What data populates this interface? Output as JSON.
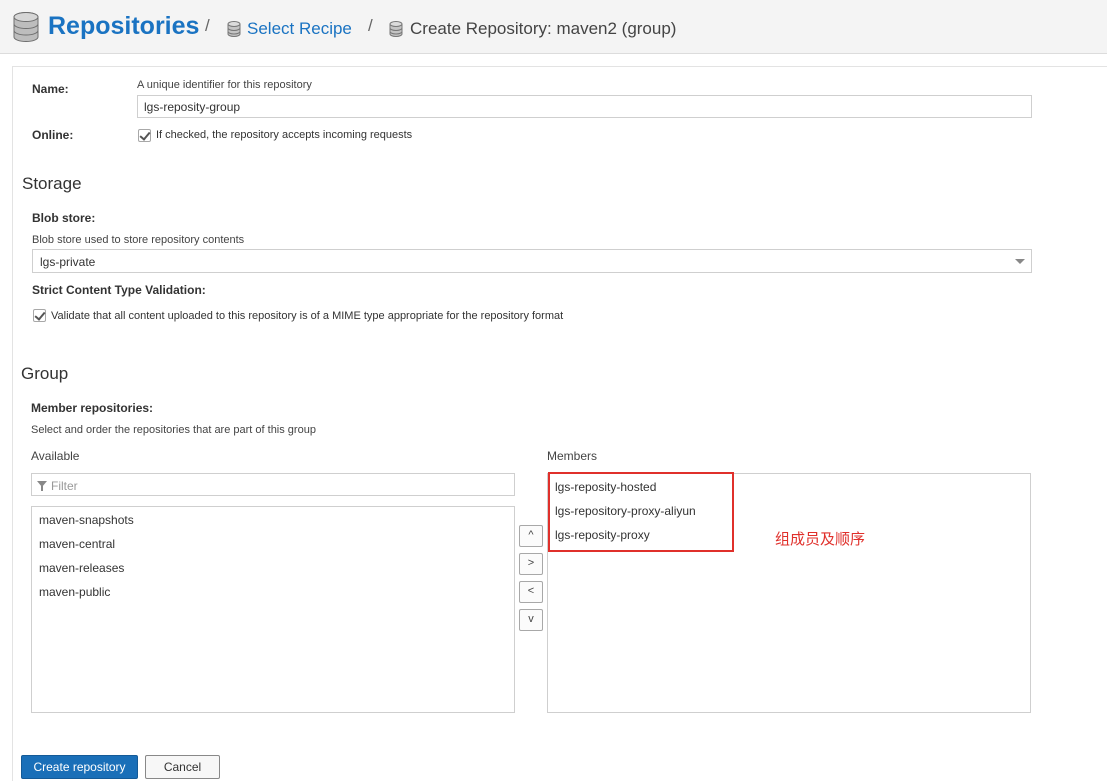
{
  "breadcrumb": {
    "title": "Repositories",
    "separator": "/",
    "link": "Select Recipe",
    "current": "Create Repository: maven2 (group)"
  },
  "form": {
    "name_label": "Name:",
    "name_help": "A unique identifier for this repository",
    "name_value": "lgs-reposity-group",
    "online_label": "Online:",
    "online_checked": true,
    "online_text": "If checked, the repository accepts incoming requests"
  },
  "storage": {
    "title": "Storage",
    "blob_label": "Blob store:",
    "blob_help": "Blob store used to store repository contents",
    "blob_value": "lgs-private",
    "strict_label": "Strict Content Type Validation:",
    "strict_checked": true,
    "strict_text": "Validate that all content uploaded to this repository is of a MIME type appropriate for the repository format"
  },
  "group": {
    "title": "Group",
    "members_label": "Member repositories:",
    "members_help": "Select and order the repositories that are part of this group",
    "available_head": "Available",
    "members_head": "Members",
    "filter_placeholder": "Filter",
    "available": [
      "maven-snapshots",
      "maven-central",
      "maven-releases",
      "maven-public"
    ],
    "members": [
      "lgs-reposity-hosted",
      "lgs-repository-proxy-aliyun",
      "lgs-reposity-proxy"
    ],
    "buttons": {
      "up": "^",
      "right": ">",
      "left": "<",
      "down": "v"
    }
  },
  "annotation": "组成员及顺序",
  "actions": {
    "create": "Create repository",
    "cancel": "Cancel"
  },
  "colors": {
    "brand": "#1a73c2",
    "primary_button": "#1a6fb8",
    "highlight": "#e0302b"
  }
}
